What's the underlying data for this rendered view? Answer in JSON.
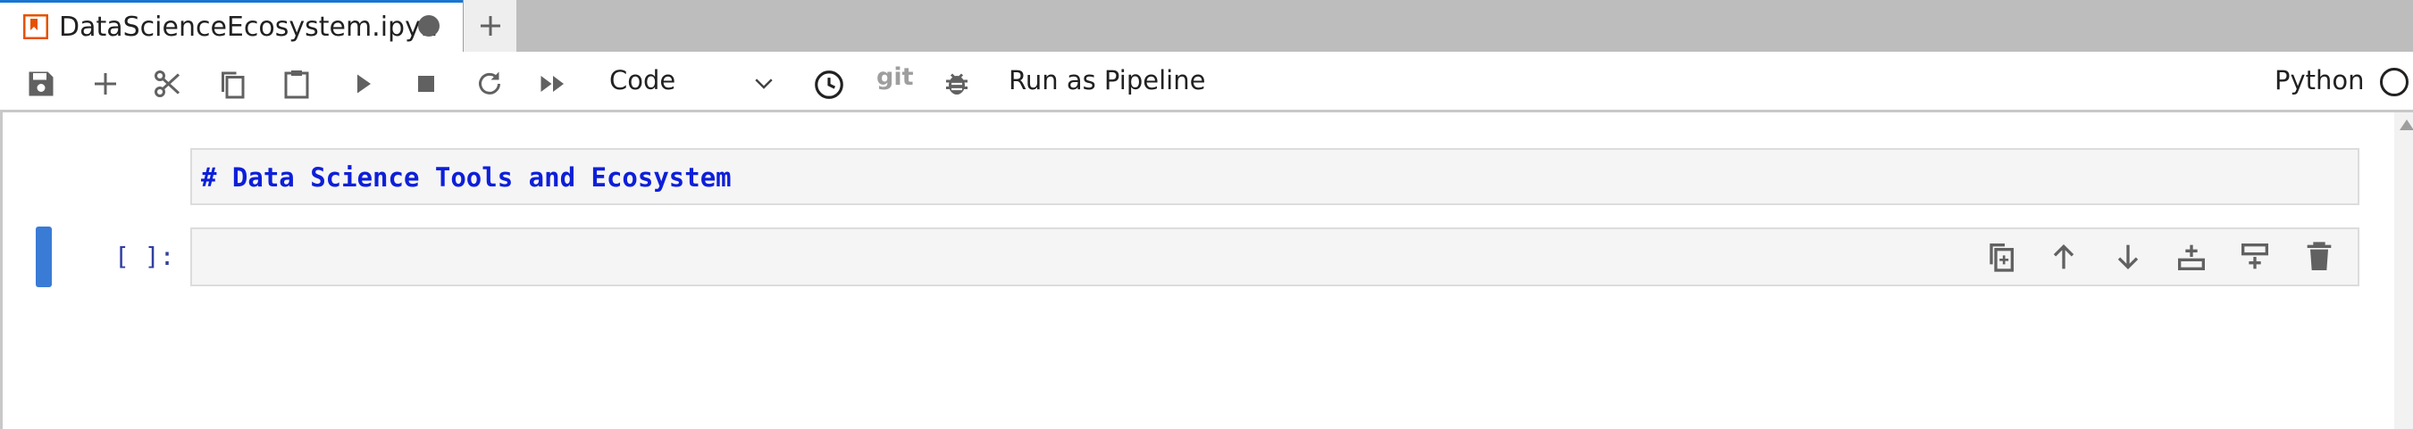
{
  "tab": {
    "title": "DataScienceEcosystem.ipyn",
    "icon": "notebook-icon",
    "accent_color": "#1976d2",
    "dirty_indicator": "unsaved-dot"
  },
  "toolbar": {
    "buttons": [
      {
        "name": "save-icon"
      },
      {
        "name": "add-cell-icon"
      },
      {
        "name": "cut-icon"
      },
      {
        "name": "copy-icon"
      },
      {
        "name": "paste-icon"
      },
      {
        "name": "run-icon"
      },
      {
        "name": "stop-icon"
      },
      {
        "name": "restart-icon"
      },
      {
        "name": "run-all-icon"
      }
    ],
    "cell_type": "Code",
    "git_label": "git",
    "pipeline_label": "Run as Pipeline",
    "kernel_name": "Python"
  },
  "notebook": {
    "cells": [
      {
        "type": "markdown",
        "source": "# Data Science Tools and Ecosystem"
      },
      {
        "type": "code",
        "prompt": "[ ]:",
        "source": "",
        "active": true
      }
    ],
    "cell_toolbar": [
      "duplicate-icon",
      "move-up-icon",
      "move-down-icon",
      "insert-below-icon",
      "insert-above-icon",
      "delete-icon"
    ],
    "code_color": "#0d1fd8",
    "active_bar_color": "#3a7bd5"
  }
}
